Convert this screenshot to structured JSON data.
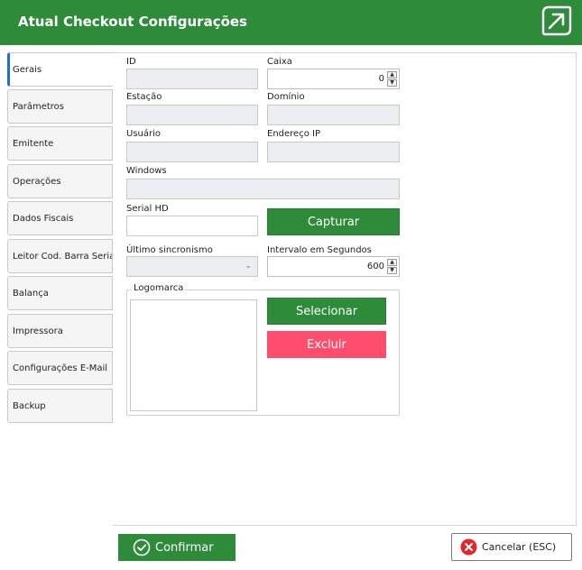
{
  "window": {
    "title": "Atual Checkout Configurações"
  },
  "tabs": [
    {
      "label": "Gerais",
      "active": true
    },
    {
      "label": "Parâmetros",
      "active": false
    },
    {
      "label": "Emitente",
      "active": false
    },
    {
      "label": "Operações",
      "active": false
    },
    {
      "label": "Dados Fiscais",
      "active": false
    },
    {
      "label": "Leitor Cod. Barra Serial",
      "active": false
    },
    {
      "label": "Balança",
      "active": false
    },
    {
      "label": "Impressora",
      "active": false
    },
    {
      "label": "Configurações E-Mail",
      "active": false
    },
    {
      "label": "Backup",
      "active": false
    }
  ],
  "form": {
    "id_label": "ID",
    "id_value": "",
    "caixa_label": "Caixa",
    "caixa_value": "0",
    "estacao_label": "Estação",
    "estacao_value": "",
    "dominio_label": "Domínio",
    "dominio_value": "",
    "usuario_label": "Usuário",
    "usuario_value": "",
    "endereco_ip_label": "Endereço IP",
    "endereco_ip_value": "",
    "windows_label": "Windows",
    "windows_value": "",
    "serial_hd_label": "Serial HD",
    "serial_hd_value": "",
    "capturar_label": "Capturar",
    "ultimo_sinc_label": "Último sincronismo",
    "ultimo_sinc_value": "",
    "intervalo_label": "Intervalo em Segundos",
    "intervalo_value": "600"
  },
  "logomarca": {
    "legend": "Logomarca",
    "selecionar_label": "Selecionar",
    "excluir_label": "Excluir"
  },
  "footer": {
    "confirm_label": "Confirmar",
    "cancel_label": "Cancelar (ESC)"
  },
  "colors": {
    "brand_green": "#2e8b3a",
    "danger_pink": "#ff4d6d",
    "active_tab_accent": "#1e6fd0",
    "cancel_icon_red": "#e02a2a"
  }
}
